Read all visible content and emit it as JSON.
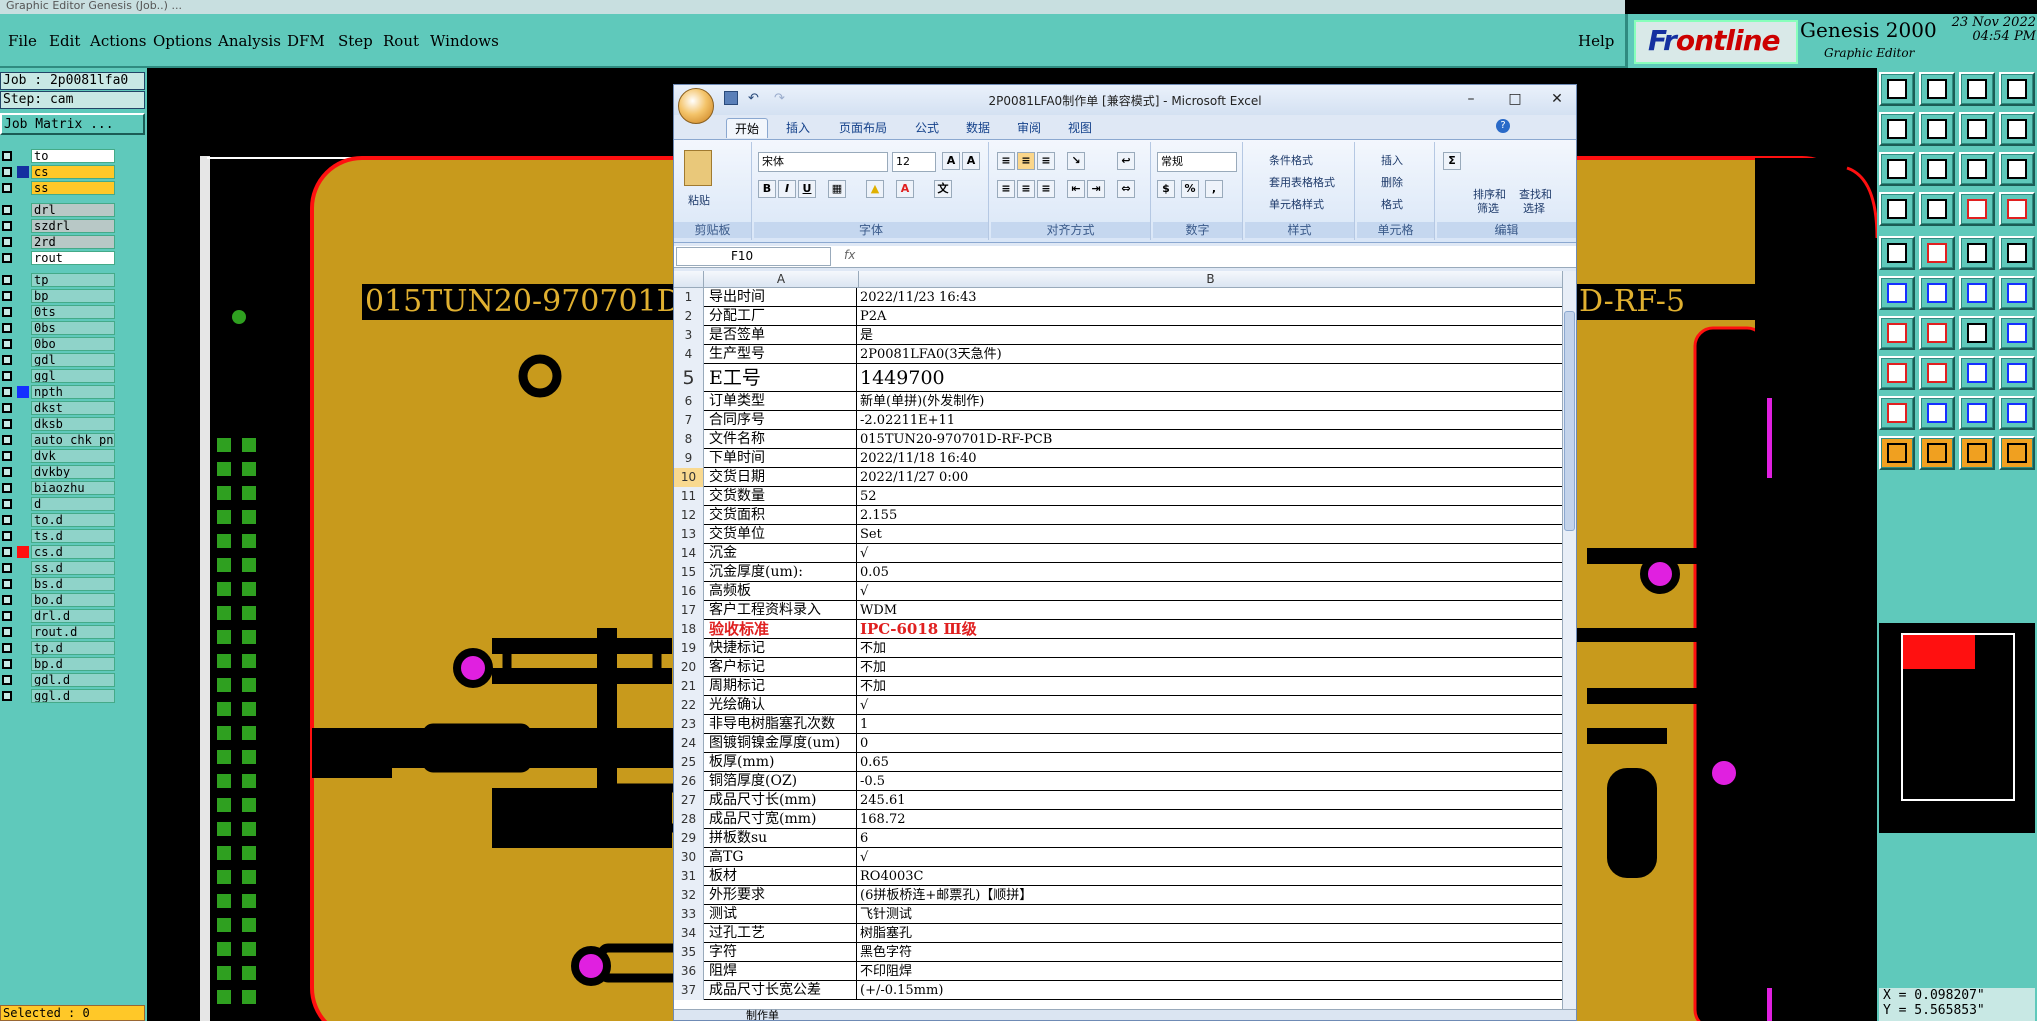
{
  "app": {
    "title_strip": "Graphic Editor Genesis (Job..) ...",
    "menu": [
      "File",
      "Edit",
      "Actions",
      "Options",
      "Analysis",
      "DFM",
      "Step",
      "Rout",
      "Windows"
    ],
    "help": "Help",
    "brand_left": "Fr",
    "brand_right": "ontline",
    "product": "Genesis 2000",
    "subtitle": "Graphic Editor",
    "date": "23 Nov 2022",
    "time": "04:54 PM"
  },
  "left": {
    "job": "Job : 2p0081lfa0",
    "step": "Step: cam",
    "matrix_button": "Job Matrix ...",
    "selected": "Selected : 0",
    "layers": [
      {
        "name": "to",
        "style": "board",
        "color": ""
      },
      {
        "name": "cs",
        "style": "yellow",
        "color": "#1530a0"
      },
      {
        "name": "ss",
        "style": "yellow",
        "color": ""
      },
      {
        "name": "drl",
        "style": "gray",
        "color": ""
      },
      {
        "name": "szdrl",
        "style": "gray",
        "color": ""
      },
      {
        "name": "2rd",
        "style": "gray",
        "color": ""
      },
      {
        "name": "rout",
        "style": "board",
        "color": ""
      },
      {
        "name": "tp",
        "style": "",
        "color": ""
      },
      {
        "name": "bp",
        "style": "",
        "color": ""
      },
      {
        "name": "0ts",
        "style": "",
        "color": ""
      },
      {
        "name": "0bs",
        "style": "",
        "color": ""
      },
      {
        "name": "0bo",
        "style": "",
        "color": ""
      },
      {
        "name": "gdl",
        "style": "",
        "color": ""
      },
      {
        "name": "ggl",
        "style": "",
        "color": ""
      },
      {
        "name": "npth",
        "style": "",
        "color": "#1530ff"
      },
      {
        "name": "dkst",
        "style": "",
        "color": ""
      },
      {
        "name": "dksb",
        "style": "",
        "color": ""
      },
      {
        "name": "auto_chk_pn",
        "style": "",
        "color": ""
      },
      {
        "name": "dvk",
        "style": "",
        "color": ""
      },
      {
        "name": "dvkby",
        "style": "",
        "color": ""
      },
      {
        "name": "biaozhu",
        "style": "",
        "color": ""
      },
      {
        "name": "d",
        "style": "",
        "color": ""
      },
      {
        "name": "to.d",
        "style": "",
        "color": ""
      },
      {
        "name": "ts.d",
        "style": "",
        "color": ""
      },
      {
        "name": "cs.d",
        "style": "",
        "color": "#ff1010"
      },
      {
        "name": "ss.d",
        "style": "",
        "color": ""
      },
      {
        "name": "bs.d",
        "style": "",
        "color": ""
      },
      {
        "name": "bo.d",
        "style": "",
        "color": ""
      },
      {
        "name": "drl.d",
        "style": "",
        "color": ""
      },
      {
        "name": "rout.d",
        "style": "",
        "color": ""
      },
      {
        "name": "tp.d",
        "style": "",
        "color": ""
      },
      {
        "name": "bp.d",
        "style": "",
        "color": ""
      },
      {
        "name": "gdl.d",
        "style": "",
        "color": ""
      },
      {
        "name": "ggl.d",
        "style": "",
        "color": ""
      }
    ]
  },
  "canvas": {
    "text_left": "015TUN20-970701D-",
    "text_right": "D-RF-5"
  },
  "right": {
    "coord_x": "X = 0.098207\"",
    "coord_y": "Y = 5.565853\""
  },
  "excel": {
    "title": "2P0081LFA0制作单 [兼容模式] - Microsoft Excel",
    "tabs": [
      "开始",
      "插入",
      "页面布局",
      "公式",
      "数据",
      "审阅",
      "视图"
    ],
    "clipboard": {
      "paste": "粘贴",
      "label": "剪贴板"
    },
    "font": {
      "name": "宋体",
      "size": "12",
      "label": "字体"
    },
    "align": {
      "label": "对齐方式"
    },
    "number": {
      "format": "常规",
      "label": "数字"
    },
    "styles": {
      "cond": "条件格式",
      "table": "套用表格格式",
      "cell": "单元格样式",
      "label": "样式"
    },
    "cells": {
      "insert": "插入",
      "delete": "删除",
      "format": "格式",
      "label": "单元格"
    },
    "edit": {
      "sort": "排序和",
      "filter": "筛选",
      "find": "查找和",
      "select": "选择",
      "label": "编辑"
    },
    "namebox": "F10",
    "fx": "fx",
    "col_a": "A",
    "col_b": "B",
    "sheet_tab": "制作单",
    "rows": [
      [
        "1",
        "导出时间",
        "2022/11/23 16:43",
        ""
      ],
      [
        "2",
        "分配工厂",
        "P2A",
        ""
      ],
      [
        "3",
        "是否签单",
        "是",
        ""
      ],
      [
        "4",
        "生产型号",
        "2P0081LFA0(3天急件)",
        ""
      ],
      [
        "5",
        "E工号",
        "1449700",
        "big"
      ],
      [
        "6",
        "订单类型",
        "新单(单拼)(外发制作)",
        ""
      ],
      [
        "7",
        "合同序号",
        "-2.02211E+11",
        ""
      ],
      [
        "8",
        "文件名称",
        "015TUN20-970701D-RF-PCB",
        ""
      ],
      [
        "9",
        "下单时间",
        "2022/11/18 16:40",
        ""
      ],
      [
        "10",
        "交货日期",
        "2022/11/27 0:00",
        "sel"
      ],
      [
        "11",
        "交货数量",
        "52",
        ""
      ],
      [
        "12",
        "交货面积",
        "2.155",
        ""
      ],
      [
        "13",
        "交货单位",
        "Set",
        ""
      ],
      [
        "14",
        "沉金",
        "√",
        ""
      ],
      [
        "15",
        "沉金厚度(um):",
        "0.05",
        ""
      ],
      [
        "16",
        "高频板",
        "√",
        ""
      ],
      [
        "17",
        "客户工程资料录入",
        "WDM",
        ""
      ],
      [
        "18",
        "验收标准",
        "IPC-6018 Ⅲ级",
        "red"
      ],
      [
        "19",
        "快捷标记",
        "不加",
        ""
      ],
      [
        "20",
        "客户标记",
        "不加",
        ""
      ],
      [
        "21",
        "周期标记",
        "不加",
        ""
      ],
      [
        "22",
        "光绘确认",
        "√",
        ""
      ],
      [
        "23",
        "非导电树脂塞孔次数",
        "1",
        ""
      ],
      [
        "24",
        "图镀铜镍金厚度(um)",
        "0",
        ""
      ],
      [
        "25",
        "板厚(mm)",
        "0.65",
        ""
      ],
      [
        "26",
        "铜箔厚度(OZ)",
        "-0.5",
        ""
      ],
      [
        "27",
        "成品尺寸长(mm)",
        "245.61",
        ""
      ],
      [
        "28",
        "成品尺寸宽(mm)",
        "168.72",
        ""
      ],
      [
        "29",
        "拼板数su",
        "6",
        ""
      ],
      [
        "30",
        "高TG",
        "√",
        ""
      ],
      [
        "31",
        "板材",
        "RO4003C",
        ""
      ],
      [
        "32",
        "外形要求",
        "(6拼板桥连+邮票孔)【顺拼】",
        ""
      ],
      [
        "33",
        "测试",
        "飞针测试",
        ""
      ],
      [
        "34",
        "过孔工艺",
        "树脂塞孔",
        ""
      ],
      [
        "35",
        "字符",
        "黑色字符",
        ""
      ],
      [
        "36",
        "阻焊",
        "不印阻焊",
        ""
      ],
      [
        "37",
        "成品尺寸长宽公差",
        "(+/-0.15mm)",
        ""
      ]
    ]
  }
}
